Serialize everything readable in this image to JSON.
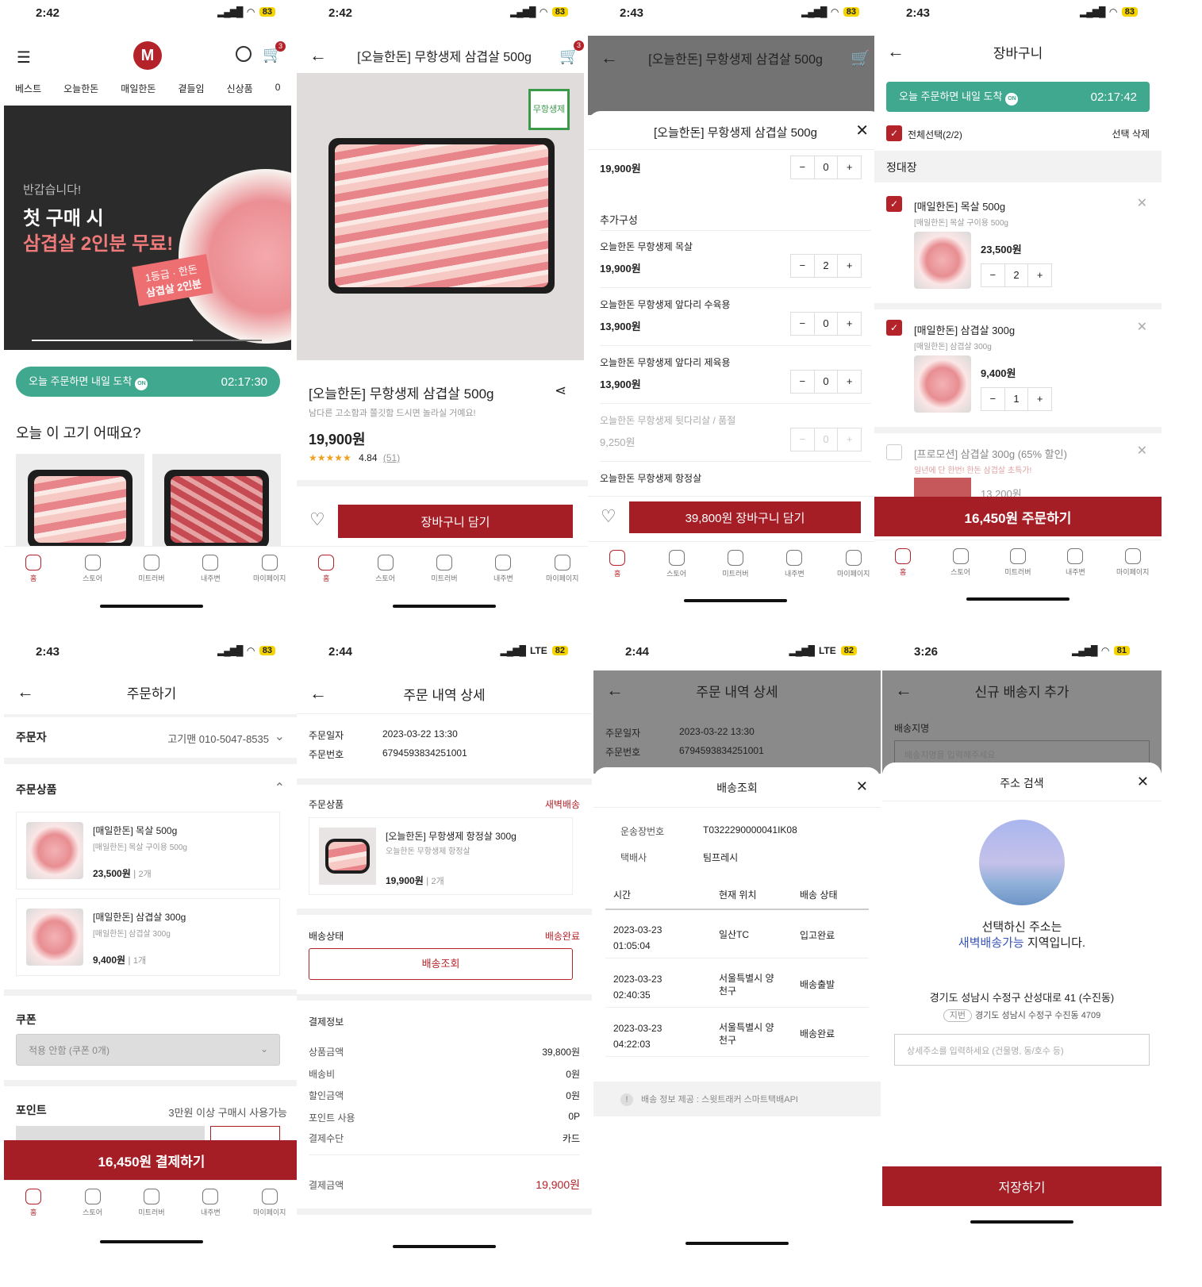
{
  "s1": {
    "time": "2:42",
    "battery": "83",
    "cart_count": "3",
    "nav": [
      "베스트",
      "오늘한돈",
      "매일한돈",
      "곁들임",
      "신상품",
      "0"
    ],
    "banner_greet": "반갑습니다!",
    "banner_line1": "첫 구매 시",
    "banner_line2": "삼겹살 2인분 무료!",
    "banner_tag1": "1등급 · 한돈",
    "banner_tag2": "삼겹살 2인분",
    "delivery": "오늘 주문하면 내일 도착",
    "timer": "02:17:30",
    "section": "오늘 이 고기 어때요?"
  },
  "tabs": [
    "홈",
    "스토어",
    "미트러버",
    "내주변",
    "마이페이지"
  ],
  "s2": {
    "time": "2:42",
    "battery": "83",
    "cart_count": "3",
    "title": "[오늘한돈] 무항생제 삼겹살 500g",
    "badge": "무항생제",
    "name": "[오늘한돈] 무항생제 삼겹살 500g",
    "desc": "남다른 고소함과 쫄깃함 드시면 놀라실 거예요!",
    "price": "19,900원",
    "rating": "4.84",
    "reviews": "(51)",
    "stars": "★★★★★",
    "cart_btn": "장바구니 담기"
  },
  "s3": {
    "time": "2:43",
    "battery": "83",
    "cart_count": "3",
    "title": "[오늘한돈] 무항생제 삼겹살 500g",
    "modal_title": "[오늘한돈] 무항생제 삼겹살 500g",
    "top_price": "19,900원",
    "top_qty": "0",
    "addon": "추가구성",
    "items": [
      {
        "name": "오늘한돈 무항생제 목살",
        "price": "19,900원",
        "qty": "2"
      },
      {
        "name": "오늘한돈 무항생제 앞다리 수육용",
        "price": "13,900원",
        "qty": "0"
      },
      {
        "name": "오늘한돈 무항생제 앞다리 제육용",
        "price": "13,900원",
        "qty": "0"
      },
      {
        "name": "오늘한돈 무항생제 뒷다리살 / 품절",
        "price": "9,250원",
        "qty": "0"
      },
      {
        "name": "오늘한돈 무항생제 항정살",
        "price": "",
        "qty": ""
      }
    ],
    "cart_btn": "39,800원 장바구니 담기"
  },
  "s4": {
    "time": "2:43",
    "battery": "83",
    "title": "장바구니",
    "delivery": "오늘 주문하면 내일 도착",
    "timer": "02:17:42",
    "select_all": "전체선택(2/2)",
    "delete_sel": "선택 삭제",
    "group": "정대장",
    "items": [
      {
        "name": "[매일한돈] 목살 500g",
        "opt": "[매일한돈] 목살 구이용 500g",
        "price": "23,500원",
        "qty": "2"
      },
      {
        "name": "[매일한돈] 삼겹살 300g",
        "opt": "[매일한돈] 삼겹살 300g",
        "price": "9,400원",
        "qty": "1"
      },
      {
        "name": "[프로모션] 삼겹살 300g (65% 할인)",
        "opt": "일년에 단 한번! 한돈 삼겹살 초특가!",
        "price": "13,200원",
        "qty": ""
      }
    ],
    "order_btn": "16,450원 주문하기"
  },
  "s5": {
    "time": "2:43",
    "battery": "83",
    "title": "주문하기",
    "orderer_label": "주문자",
    "orderer": "고기맨 010-5047-8535",
    "products_label": "주문상품",
    "items": [
      {
        "name": "[매일한돈] 목살 500g",
        "opt": "[매일한돈] 목살 구이용 500g",
        "price": "23,500원",
        "qty": "2개"
      },
      {
        "name": "[매일한돈] 삼겹살 300g",
        "opt": "[매일한돈] 삼겹살 300g",
        "price": "9,400원",
        "qty": "1개"
      }
    ],
    "coupon_label": "쿠폰",
    "coupon_value": "적용 안함 (쿠폰 0개)",
    "point_label": "포인트",
    "point_note": "3만원 이상 구매시 사용가능",
    "pay_btn": "16,450원 결제하기"
  },
  "s6": {
    "time": "2:44",
    "battery": "82",
    "net": "LTE",
    "title": "주문 내역 상세",
    "date_label": "주문일자",
    "date": "2023-03-22 13:30",
    "no_label": "주문번호",
    "no": "6794593834251001",
    "products_label": "주문상품",
    "dawn": "새벽배송",
    "item_name": "[오늘한돈] 무항생제 항정살 300g",
    "item_opt": "오늘한돈 무항생제 항정살",
    "item_price": "19,900원",
    "item_qty": "2개",
    "status_label": "배송상태",
    "status": "배송완료",
    "track_btn": "배송조회",
    "pay_label": "결제정보",
    "pay_rows": [
      [
        "상품금액",
        "39,800원"
      ],
      [
        "배송비",
        "0원"
      ],
      [
        "할인금액",
        "0원"
      ],
      [
        "포인트 사용",
        "0P"
      ],
      [
        "결제수단",
        "카드"
      ]
    ],
    "total_label": "결제금액",
    "total": "19,900원"
  },
  "s7": {
    "time": "2:44",
    "battery": "82",
    "net": "LTE",
    "title": "주문 내역 상세",
    "date_label": "주문일자",
    "date": "2023-03-22 13:30",
    "no_label": "주문번호",
    "no": "6794593834251001",
    "modal_title": "배송조회",
    "inv_label": "운송장번호",
    "inv": "T0322290000041IK08",
    "courier_label": "택배사",
    "courier": "팀프레시",
    "cols": [
      "시간",
      "현재 위치",
      "배송 상태"
    ],
    "rows": [
      [
        "2023-03-23",
        "01:05:04",
        "일산TC",
        "",
        "입고완료"
      ],
      [
        "2023-03-23",
        "02:40:35",
        "서울특별시 양",
        "천구",
        "배송출발"
      ],
      [
        "2023-03-23",
        "04:22:03",
        "서울특별시 양",
        "천구",
        "배송완료"
      ]
    ],
    "notice": "배송 정보 제공 : 스윗트래커 스마트택배API"
  },
  "s8": {
    "time": "3:26",
    "battery": "81",
    "title": "신규 배송지 추가",
    "name_label": "배송지명",
    "name_ph": "배송지명을 입력해주세요",
    "modal_title": "주소 검색",
    "msg1": "선택하신 주소는",
    "msg2a": "새벽배송가능",
    "msg2b": " 지역입니다.",
    "addr": "경기도 성남시 수정구 산성대로 41 (수진동)",
    "jibun_tag": "지번",
    "jibun": "경기도 성남시 수정구 수진동 4709",
    "detail_ph": "상세주소를 입력하세요 (건물명, 동/호수 등)",
    "save_btn": "저장하기"
  },
  "colors": {
    "brand": "#a51e25",
    "green": "#3fa88e",
    "blue": "#3a55b8"
  }
}
